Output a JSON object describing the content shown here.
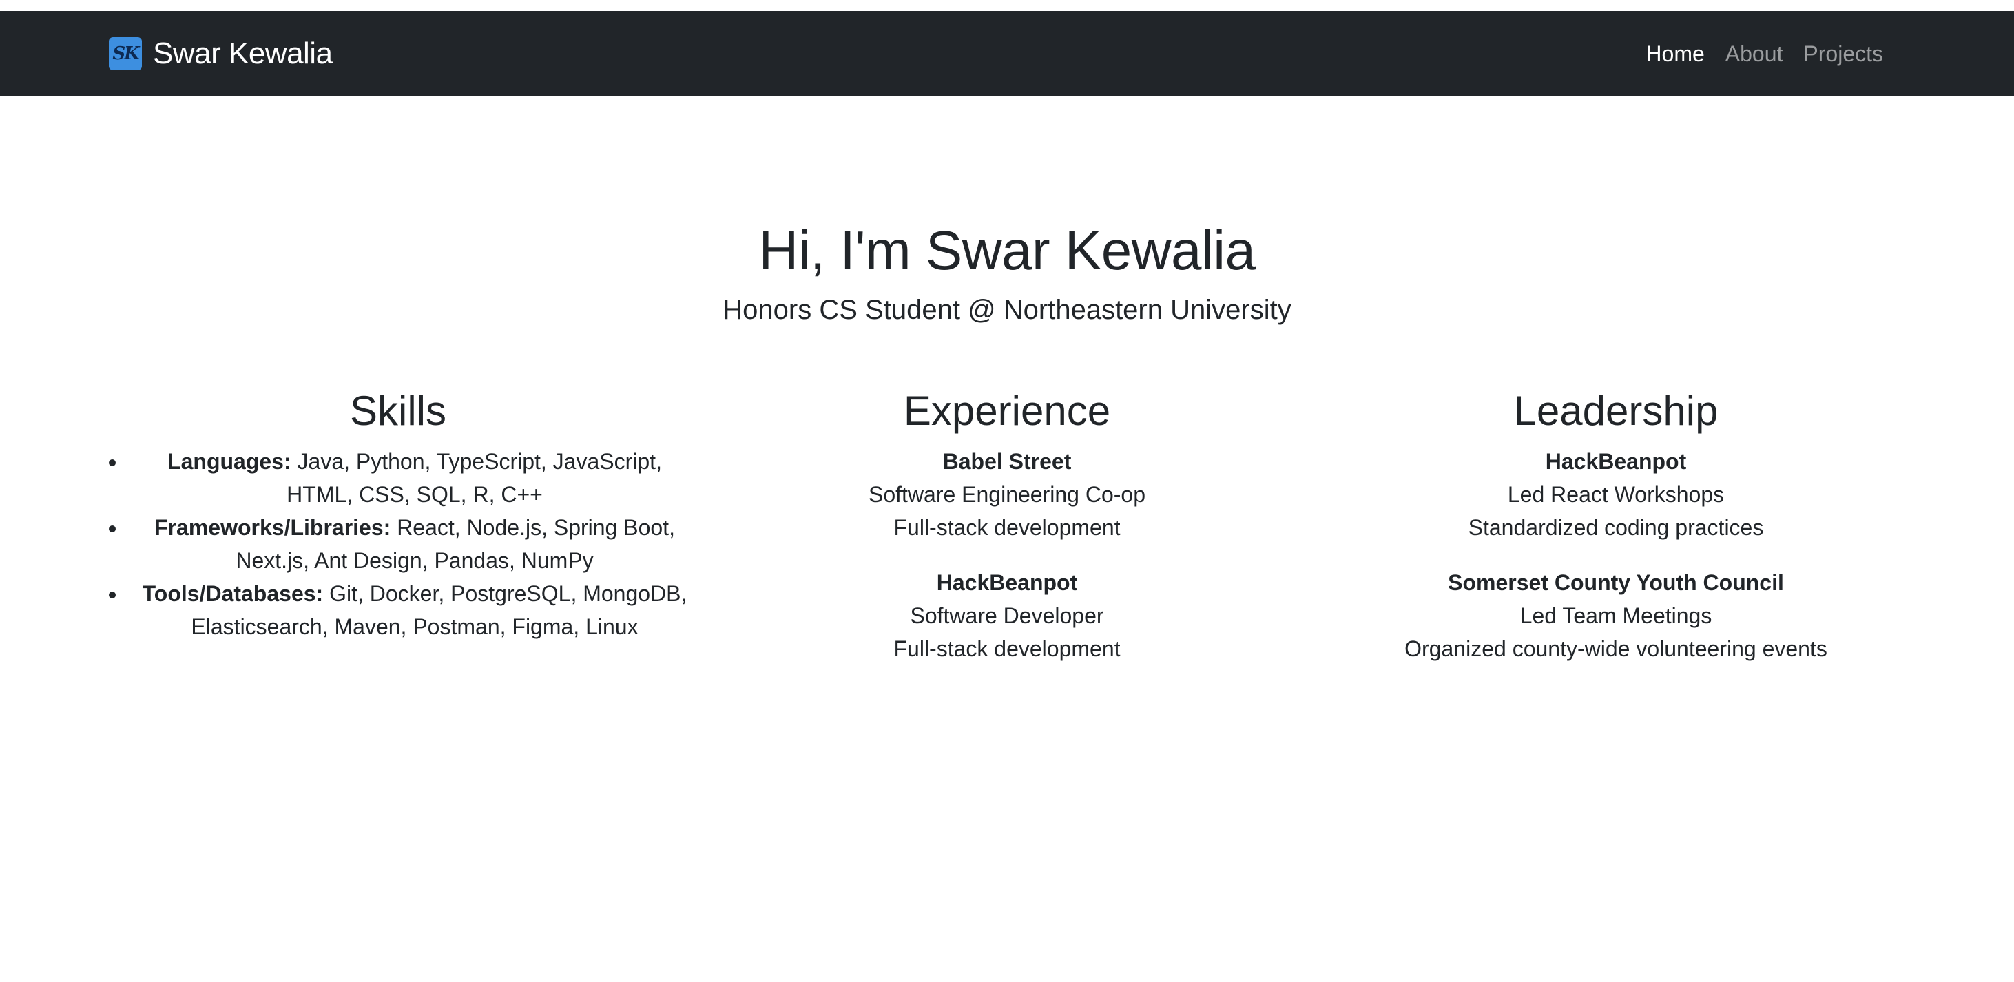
{
  "navbar": {
    "logo_text": "SK",
    "brand": "Swar Kewalia",
    "links": [
      {
        "label": "Home",
        "active": true
      },
      {
        "label": "About",
        "active": false
      },
      {
        "label": "Projects",
        "active": false
      }
    ]
  },
  "hero": {
    "title": "Hi, I'm Swar Kewalia",
    "subtitle": "Honors CS Student @ Northeastern University"
  },
  "skills": {
    "heading": "Skills",
    "items": [
      {
        "label": "Languages:",
        "value": " Java, Python, TypeScript, JavaScript, HTML, CSS, SQL, R, C++"
      },
      {
        "label": "Frameworks/Libraries:",
        "value": " React, Node.js, Spring Boot, Next.js, Ant Design, Pandas, NumPy"
      },
      {
        "label": "Tools/Databases:",
        "value": " Git, Docker, PostgreSQL, MongoDB, Elasticsearch, Maven, Postman, Figma, Linux"
      }
    ]
  },
  "experience": {
    "heading": "Experience",
    "entries": [
      {
        "org": "Babel Street",
        "role": "Software Engineering Co-op",
        "detail": "Full-stack development"
      },
      {
        "org": "HackBeanpot",
        "role": "Software Developer",
        "detail": "Full-stack development"
      }
    ]
  },
  "leadership": {
    "heading": "Leadership",
    "entries": [
      {
        "org": "HackBeanpot",
        "role": "Led React Workshops",
        "detail": "Standardized coding practices"
      },
      {
        "org": "Somerset County Youth Council",
        "role": "Led Team Meetings",
        "detail": "Organized county-wide volunteering events"
      }
    ]
  },
  "colors": {
    "navbar_bg": "#212529",
    "text": "#212529",
    "logo_bg": "#3d8fe0"
  }
}
